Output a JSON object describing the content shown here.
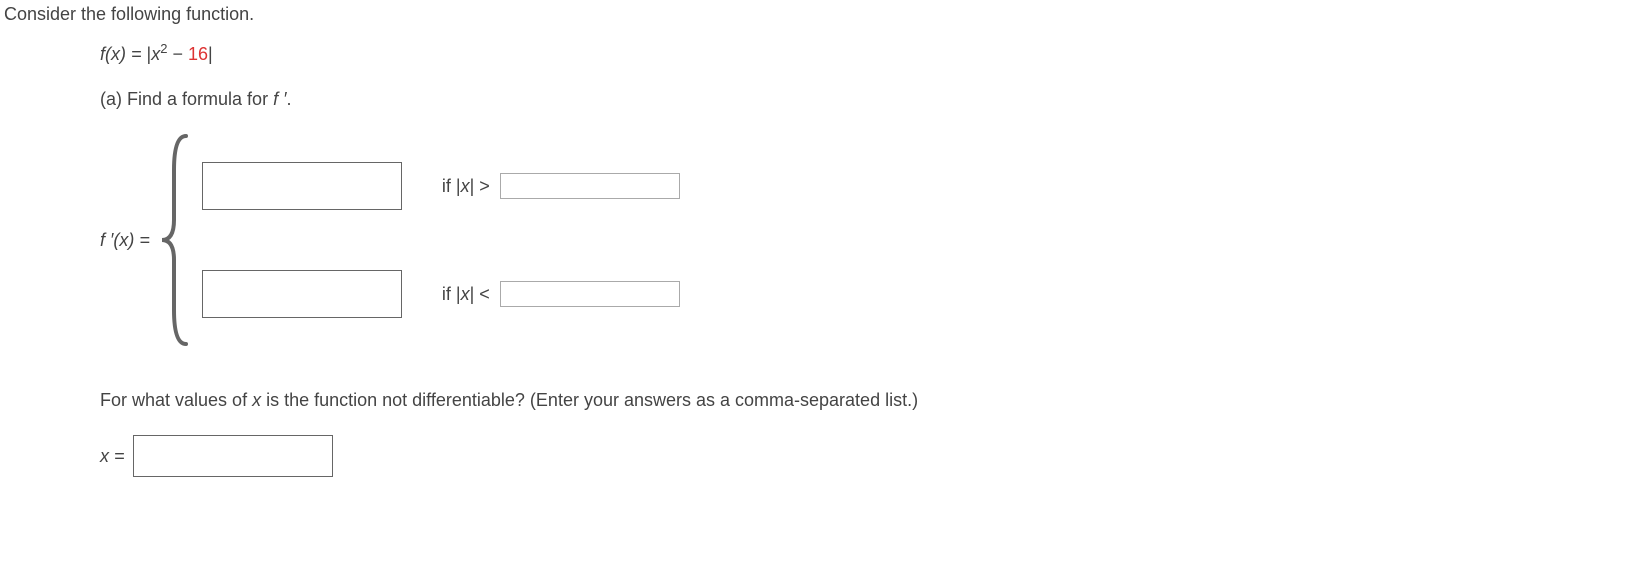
{
  "intro": "Consider the following function.",
  "function": {
    "lhs": "f(x)",
    "eq": " = ",
    "abs_open": "|",
    "var": "x",
    "exp": "2",
    "minus": " − ",
    "constant": "16",
    "abs_close": "|"
  },
  "part_a": {
    "label": "(a)",
    "text": "  Find a formula for ",
    "fprime": "f ′",
    "period": "."
  },
  "piecewise": {
    "lhs": "f ′(x) = ",
    "case1": {
      "value": "",
      "cond_if": "if |",
      "cond_x": "x",
      "cond_op": "| > ",
      "cond_val": ""
    },
    "case2": {
      "value": "",
      "cond_if": "if |",
      "cond_x": "x",
      "cond_op": "| < ",
      "cond_val": ""
    }
  },
  "part_b": {
    "text1": "For what values of ",
    "x": "x",
    "text2": " is the function not differentiable? (Enter your answers as a comma-separated list.)"
  },
  "x_equals": {
    "label": "x = ",
    "value": ""
  }
}
